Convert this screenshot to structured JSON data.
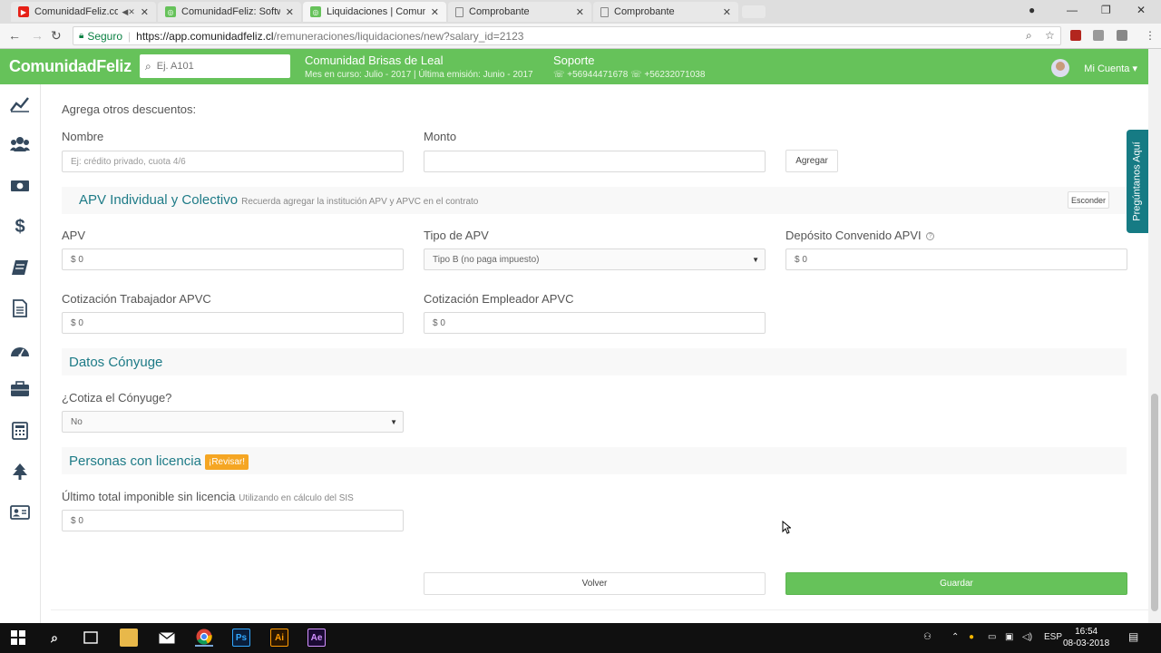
{
  "browser": {
    "tabs": [
      {
        "title": "ComunidadFeliz.com",
        "favicon": "youtube-icon",
        "muted": true
      },
      {
        "title": "ComunidadFeliz: Softwa",
        "favicon": "comunidadfeliz-icon"
      },
      {
        "title": "Liquidaciones | Comunid",
        "favicon": "comunidadfeliz-icon",
        "active": true
      },
      {
        "title": "Comprobante",
        "favicon": "document-icon"
      },
      {
        "title": "Comprobante",
        "favicon": "document-icon"
      }
    ],
    "address": {
      "secure_label": "Seguro",
      "url_host": "https://app.comunidadfeliz.cl",
      "url_path": "/remuneraciones/liquidaciones/new?salary_id=2123"
    }
  },
  "header": {
    "logo": "ComunidadFeliz",
    "search_placeholder": "Ej. A101",
    "community_name": "Comunidad Brisas de Leal",
    "community_sub": "Mes en curso: Julio - 2017 | Última emisión: Junio - 2017",
    "support_title": "Soporte",
    "support_phones": "☏ +56944471678 ☏ +56232071038",
    "account_label": "Mi Cuenta ▾"
  },
  "otros_descuentos": {
    "title": "Agrega otros descuentos:",
    "name_label": "Nombre",
    "name_placeholder": "Ej: crédito privado, cuota 4/6",
    "amount_label": "Monto",
    "add_button": "Agregar"
  },
  "apv": {
    "title": "APV Individual y Colectivo",
    "note": "Recuerda agregar la institución APV y APVC en el contrato",
    "hide_button": "Esconder",
    "apv_label": "APV",
    "apv_value": "$ 0",
    "tipo_label": "Tipo de APV",
    "tipo_value": "Tipo B (no paga impuesto)",
    "deposito_label": "Depósito Convenido APVI",
    "deposito_value": "$ 0",
    "trab_label": "Cotización Trabajador APVC",
    "trab_value": "$ 0",
    "emp_label": "Cotización Empleador APVC",
    "emp_value": "$ 0"
  },
  "conyuge": {
    "title": "Datos Cónyuge",
    "question": "¿Cotiza el Cónyuge?",
    "value": "No"
  },
  "licencia": {
    "title": "Personas con licencia",
    "badge": "¡Revisar!",
    "imponible_label": "Último total imponible sin licencia",
    "imponible_hint": "Utilizando en cálculo del SIS",
    "imponible_value": "$ 0"
  },
  "actions": {
    "back": "Volver",
    "save": "Guardar"
  },
  "help_tab": "Pregúntanos Aquí",
  "taskbar": {
    "time": "16:54",
    "date": "08-03-2018",
    "lang": "ESP"
  },
  "colors": {
    "brand_green": "#66c25a",
    "teal": "#1e7b87",
    "badge_orange": "#f5a623"
  }
}
